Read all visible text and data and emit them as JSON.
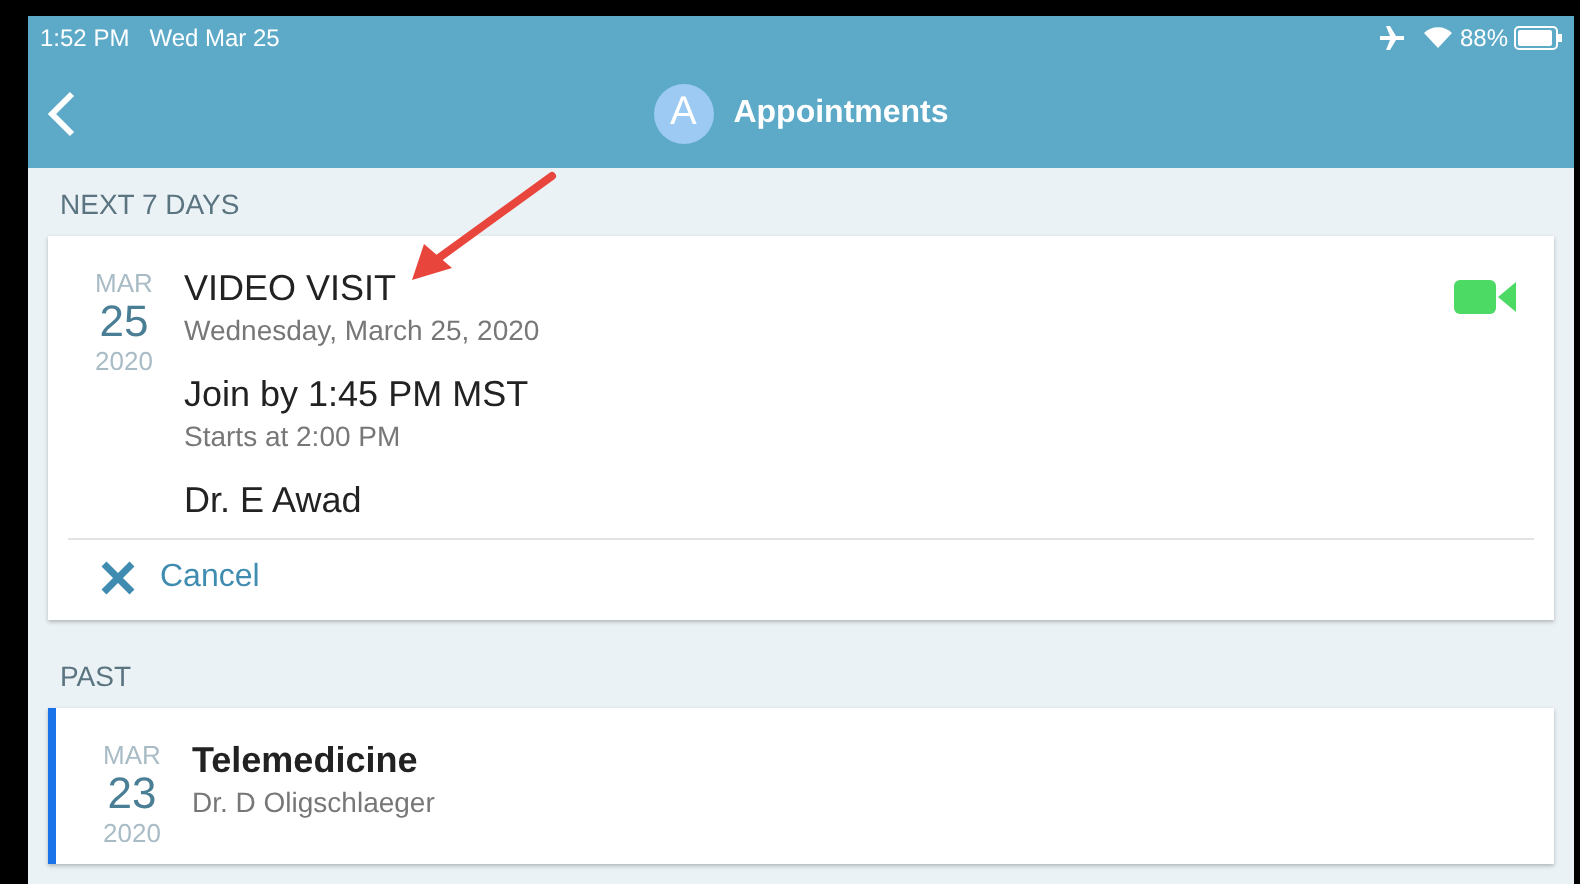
{
  "status_bar": {
    "time": "1:52 PM",
    "date": "Wed Mar 25",
    "battery": "88%"
  },
  "nav": {
    "avatar": "A",
    "title": "Appointments"
  },
  "sections": [
    {
      "header": "NEXT 7 DAYS",
      "appointments": [
        {
          "kind": "upcoming",
          "selected": false,
          "month": "MAR",
          "day": "25",
          "year": "2020",
          "title": "VIDEO VISIT",
          "subtitle": "Wednesday, March 25, 2020",
          "join": "Join by 1:45 PM MST",
          "starts": "Starts at 2:00 PM",
          "doctor": "Dr. E Awad",
          "action": "Cancel"
        }
      ]
    },
    {
      "header": "PAST",
      "appointments": [
        {
          "kind": "past",
          "selected": true,
          "month": "MAR",
          "day": "23",
          "year": "2020",
          "title": "Telemedicine",
          "subtitle": "Dr. D Oligschlaeger"
        }
      ]
    }
  ]
}
